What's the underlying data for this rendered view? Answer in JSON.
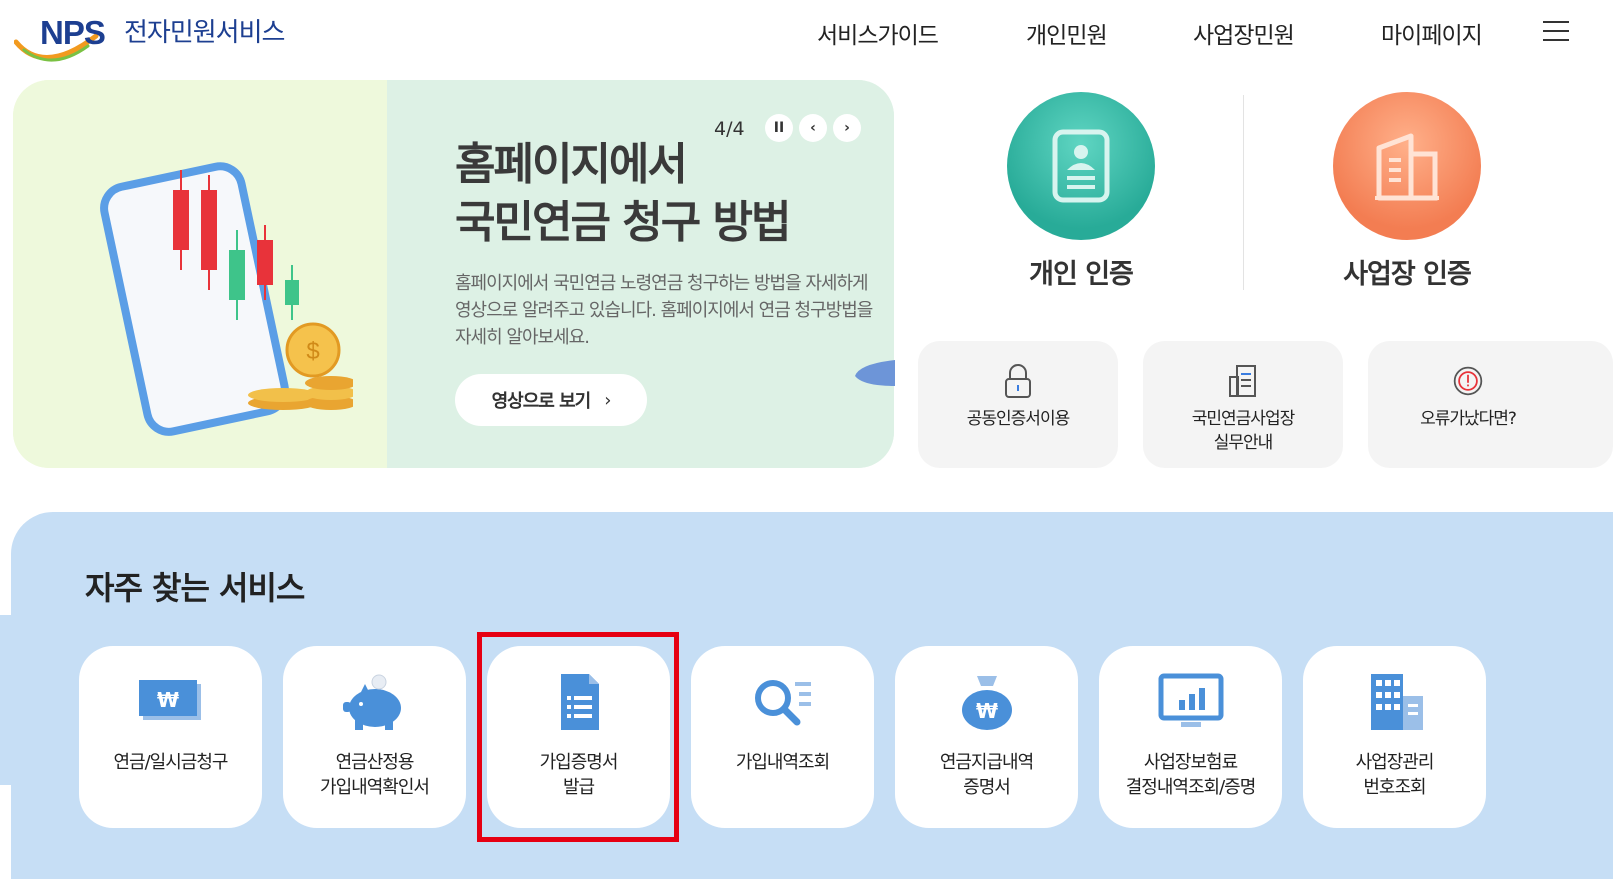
{
  "header": {
    "logo_text": "NPS",
    "service_name": "전자민원서비스",
    "nav": [
      "서비스가이드",
      "개인민원",
      "사업장민원",
      "마이페이지"
    ],
    "menu_icon": "hamburger-menu-icon"
  },
  "banner": {
    "counter": "4/4",
    "title_line1": "홈페이지에서",
    "title_line2": "국민연금 청구 방법",
    "description": "홈페이지에서 국민연금 노령연금 청구하는 방법을 자세하게 영상으로 알려주고 있습니다. 홈페이지에서 연금 청구방법을 자세히 알아보세요.",
    "button_label": "영상으로 보기",
    "pause_glyph": "II",
    "prev_glyph": "‹",
    "next_glyph": "›"
  },
  "auth": {
    "personal_label": "개인 인증",
    "business_label": "사업장 인증"
  },
  "quick_links": [
    {
      "label": "공동인증서이용",
      "icon": "lock-icon"
    },
    {
      "label_line1": "국민연금사업장",
      "label_line2": "실무안내",
      "icon": "document-building-icon"
    },
    {
      "label": "오류가났다면?",
      "icon": "exclamation-circle-icon"
    }
  ],
  "frequent": {
    "title": "자주 찾는 서비스",
    "cards": [
      {
        "line1": "연금/일시금청구",
        "line2": "",
        "icon": "won-bill-icon"
      },
      {
        "line1": "연금산정용",
        "line2": "가입내역확인서",
        "icon": "piggy-bank-icon"
      },
      {
        "line1": "가입증명서",
        "line2": "발급",
        "icon": "document-list-icon"
      },
      {
        "line1": "가입내역조회",
        "line2": "",
        "icon": "search-list-icon"
      },
      {
        "line1": "연금지급내역",
        "line2": "증명서",
        "icon": "money-bag-icon"
      },
      {
        "line1": "사업장보험료",
        "line2": "결정내역조회/증명",
        "icon": "monitor-chart-icon"
      },
      {
        "line1": "사업장관리",
        "line2": "번호조회",
        "icon": "office-building-icon"
      }
    ]
  },
  "colors": {
    "brand_navy": "#1d3f91",
    "teal": "#28ab98",
    "orange": "#f37d52",
    "icon_blue": "#4a90d9",
    "section_bg": "#c6def5",
    "highlight_red": "#e60012"
  }
}
